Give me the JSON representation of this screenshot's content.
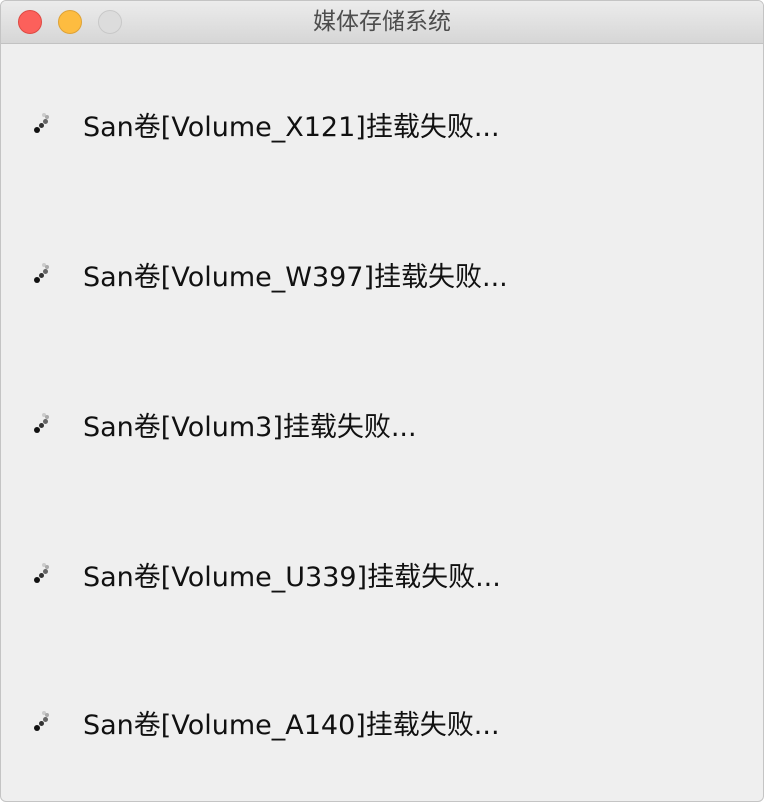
{
  "window": {
    "title": "媒体存储系统"
  },
  "icons": {
    "close": "close-button-icon",
    "minimize": "minimize-button-icon",
    "zoom": "zoom-button-icon",
    "spinner": "loading-spinner-icon"
  },
  "colors": {
    "close": "#fc605b",
    "minimize": "#fdbc40",
    "zoom": "#dcdcdc",
    "background": "#efefef"
  },
  "items": [
    {
      "label": "San卷[Volume_X121]挂载失败..."
    },
    {
      "label": "San卷[Volume_W397]挂载失败..."
    },
    {
      "label": "San卷[Volum3]挂载失败..."
    },
    {
      "label": "San卷[Volume_U339]挂载失败..."
    },
    {
      "label": "San卷[Volume_A140]挂载失败..."
    }
  ]
}
